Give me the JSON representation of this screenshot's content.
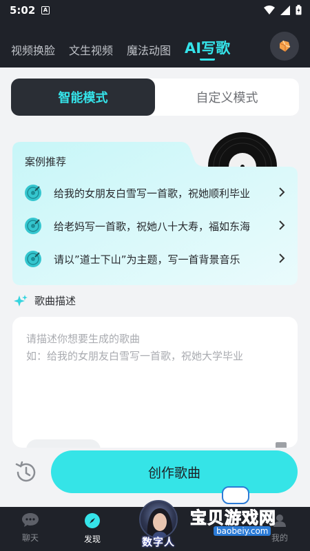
{
  "status_bar": {
    "time": "5:02",
    "notif_letter": "A"
  },
  "header": {
    "tabs": [
      {
        "label": "视频换脸",
        "active": false
      },
      {
        "label": "文生视频",
        "active": false
      },
      {
        "label": "魔法动图",
        "active": false
      },
      {
        "label": "AI写歌",
        "active": true
      }
    ]
  },
  "mode_switch": {
    "smart": "智能模式",
    "custom": "自定义模式",
    "selected": "smart"
  },
  "recommend": {
    "title": "案例推荐",
    "items": [
      "给我的女朋友白雪写一首歌，祝她顺利毕业",
      "给老妈写一首歌，祝她八十大寿，福如东海",
      "请以”道士下山”为主题，写一首背景音乐"
    ]
  },
  "description": {
    "label": "歌曲描述",
    "placeholder": "请描述你想要生成的歌曲\n如：给我的女朋友白雪写一首歌，祝她大学毕业",
    "value": ""
  },
  "actions": {
    "create": "创作歌曲"
  },
  "bottom_nav": {
    "items": [
      {
        "label": "聊天",
        "icon": "chat-icon",
        "active": false
      },
      {
        "label": "发现",
        "icon": "compass-icon",
        "active": true
      },
      {
        "label": "数字人",
        "icon": "digital-human-avatar",
        "active": false
      },
      {
        "label": "我的",
        "icon": "profile-icon",
        "active": false
      }
    ]
  },
  "watermark": {
    "name": "宝贝游戏网",
    "url": "baobeiy.com"
  },
  "colors": {
    "accent": "#35e4ea",
    "dark": "#1f2229",
    "background": "#f2f3f5"
  }
}
